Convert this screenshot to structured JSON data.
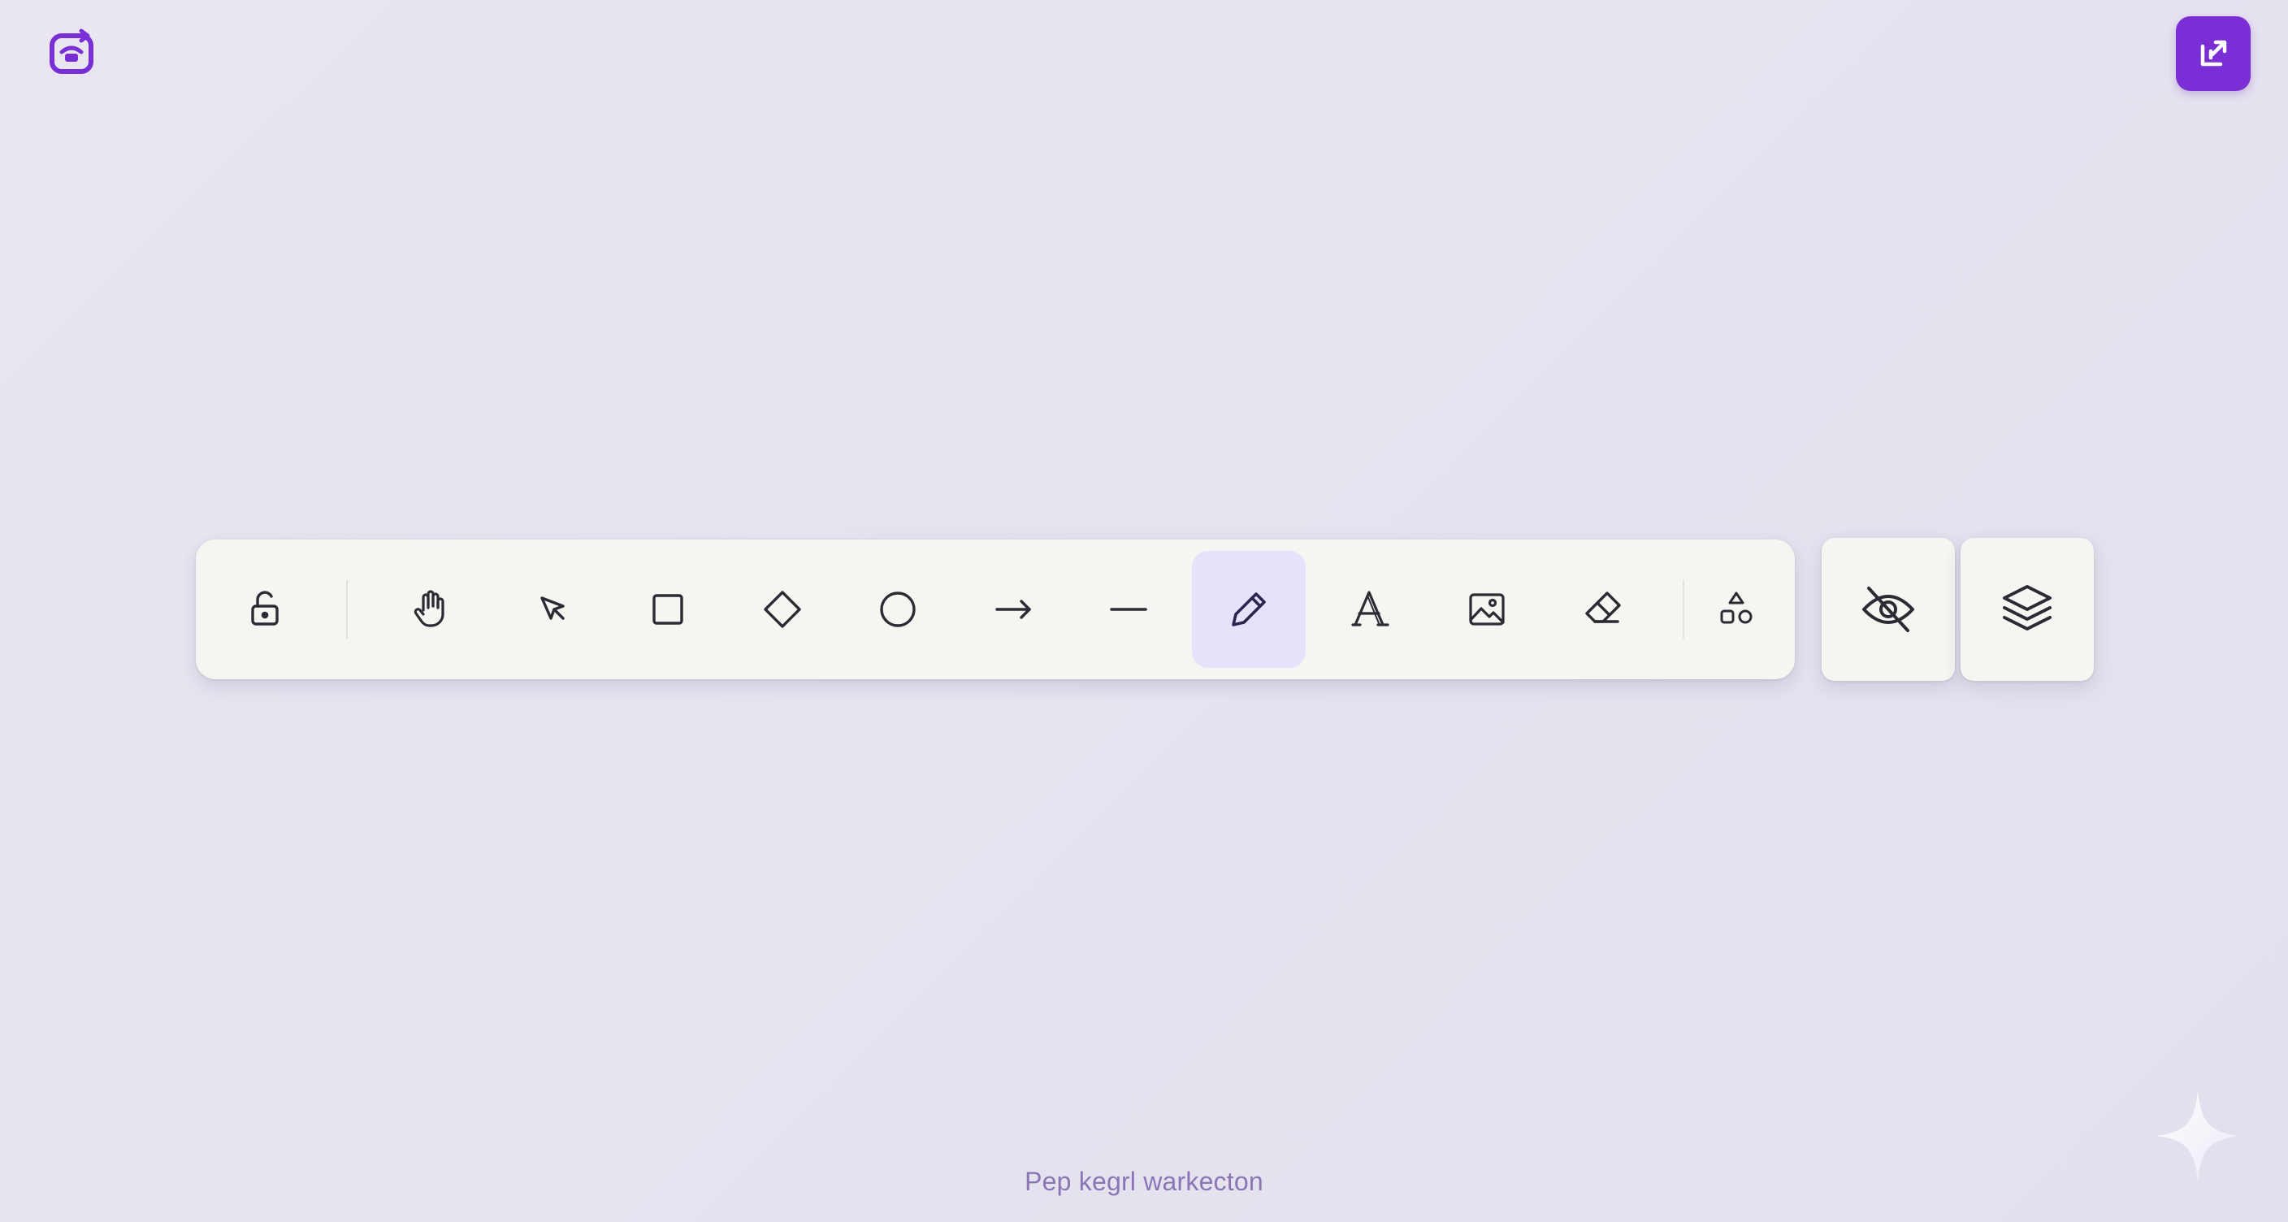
{
  "app": {
    "logo_icon": "app-logo-icon",
    "corner_button_icon": "expand-arrow-icon"
  },
  "colors": {
    "accent": "#7a2fd6",
    "toolbar_bg": "#f5f5f1",
    "active_tool_bg": "#e5e3fb",
    "icon_stroke": "#2b2b33",
    "active_icon_stroke": "#2a2450",
    "footer_text": "#8a75b5",
    "canvas_bg": "#e7e4f0"
  },
  "toolbar": {
    "tools": [
      {
        "id": "lock",
        "icon": "lock-open-icon"
      },
      {
        "id": "hand",
        "icon": "hand-icon"
      },
      {
        "id": "select",
        "icon": "pointer-icon"
      },
      {
        "id": "rectangle",
        "icon": "rectangle-icon"
      },
      {
        "id": "diamond",
        "icon": "diamond-icon"
      },
      {
        "id": "ellipse",
        "icon": "circle-icon"
      },
      {
        "id": "arrow",
        "icon": "arrow-right-icon"
      },
      {
        "id": "line",
        "icon": "line-icon"
      },
      {
        "id": "draw",
        "icon": "pencil-icon",
        "active": true
      },
      {
        "id": "text",
        "icon": "text-icon"
      },
      {
        "id": "image",
        "icon": "image-icon"
      },
      {
        "id": "eraser",
        "icon": "eraser-icon"
      },
      {
        "id": "shapes",
        "icon": "shapes-icon"
      }
    ],
    "active_tool": "draw"
  },
  "side_buttons": [
    {
      "id": "visibility",
      "icon": "eye-off-icon"
    },
    {
      "id": "layers",
      "icon": "layers-icon"
    }
  ],
  "footer": {
    "text": "Pep kegrl warkecton"
  },
  "decorations": {
    "sparkle_icon": "sparkle-icon"
  }
}
